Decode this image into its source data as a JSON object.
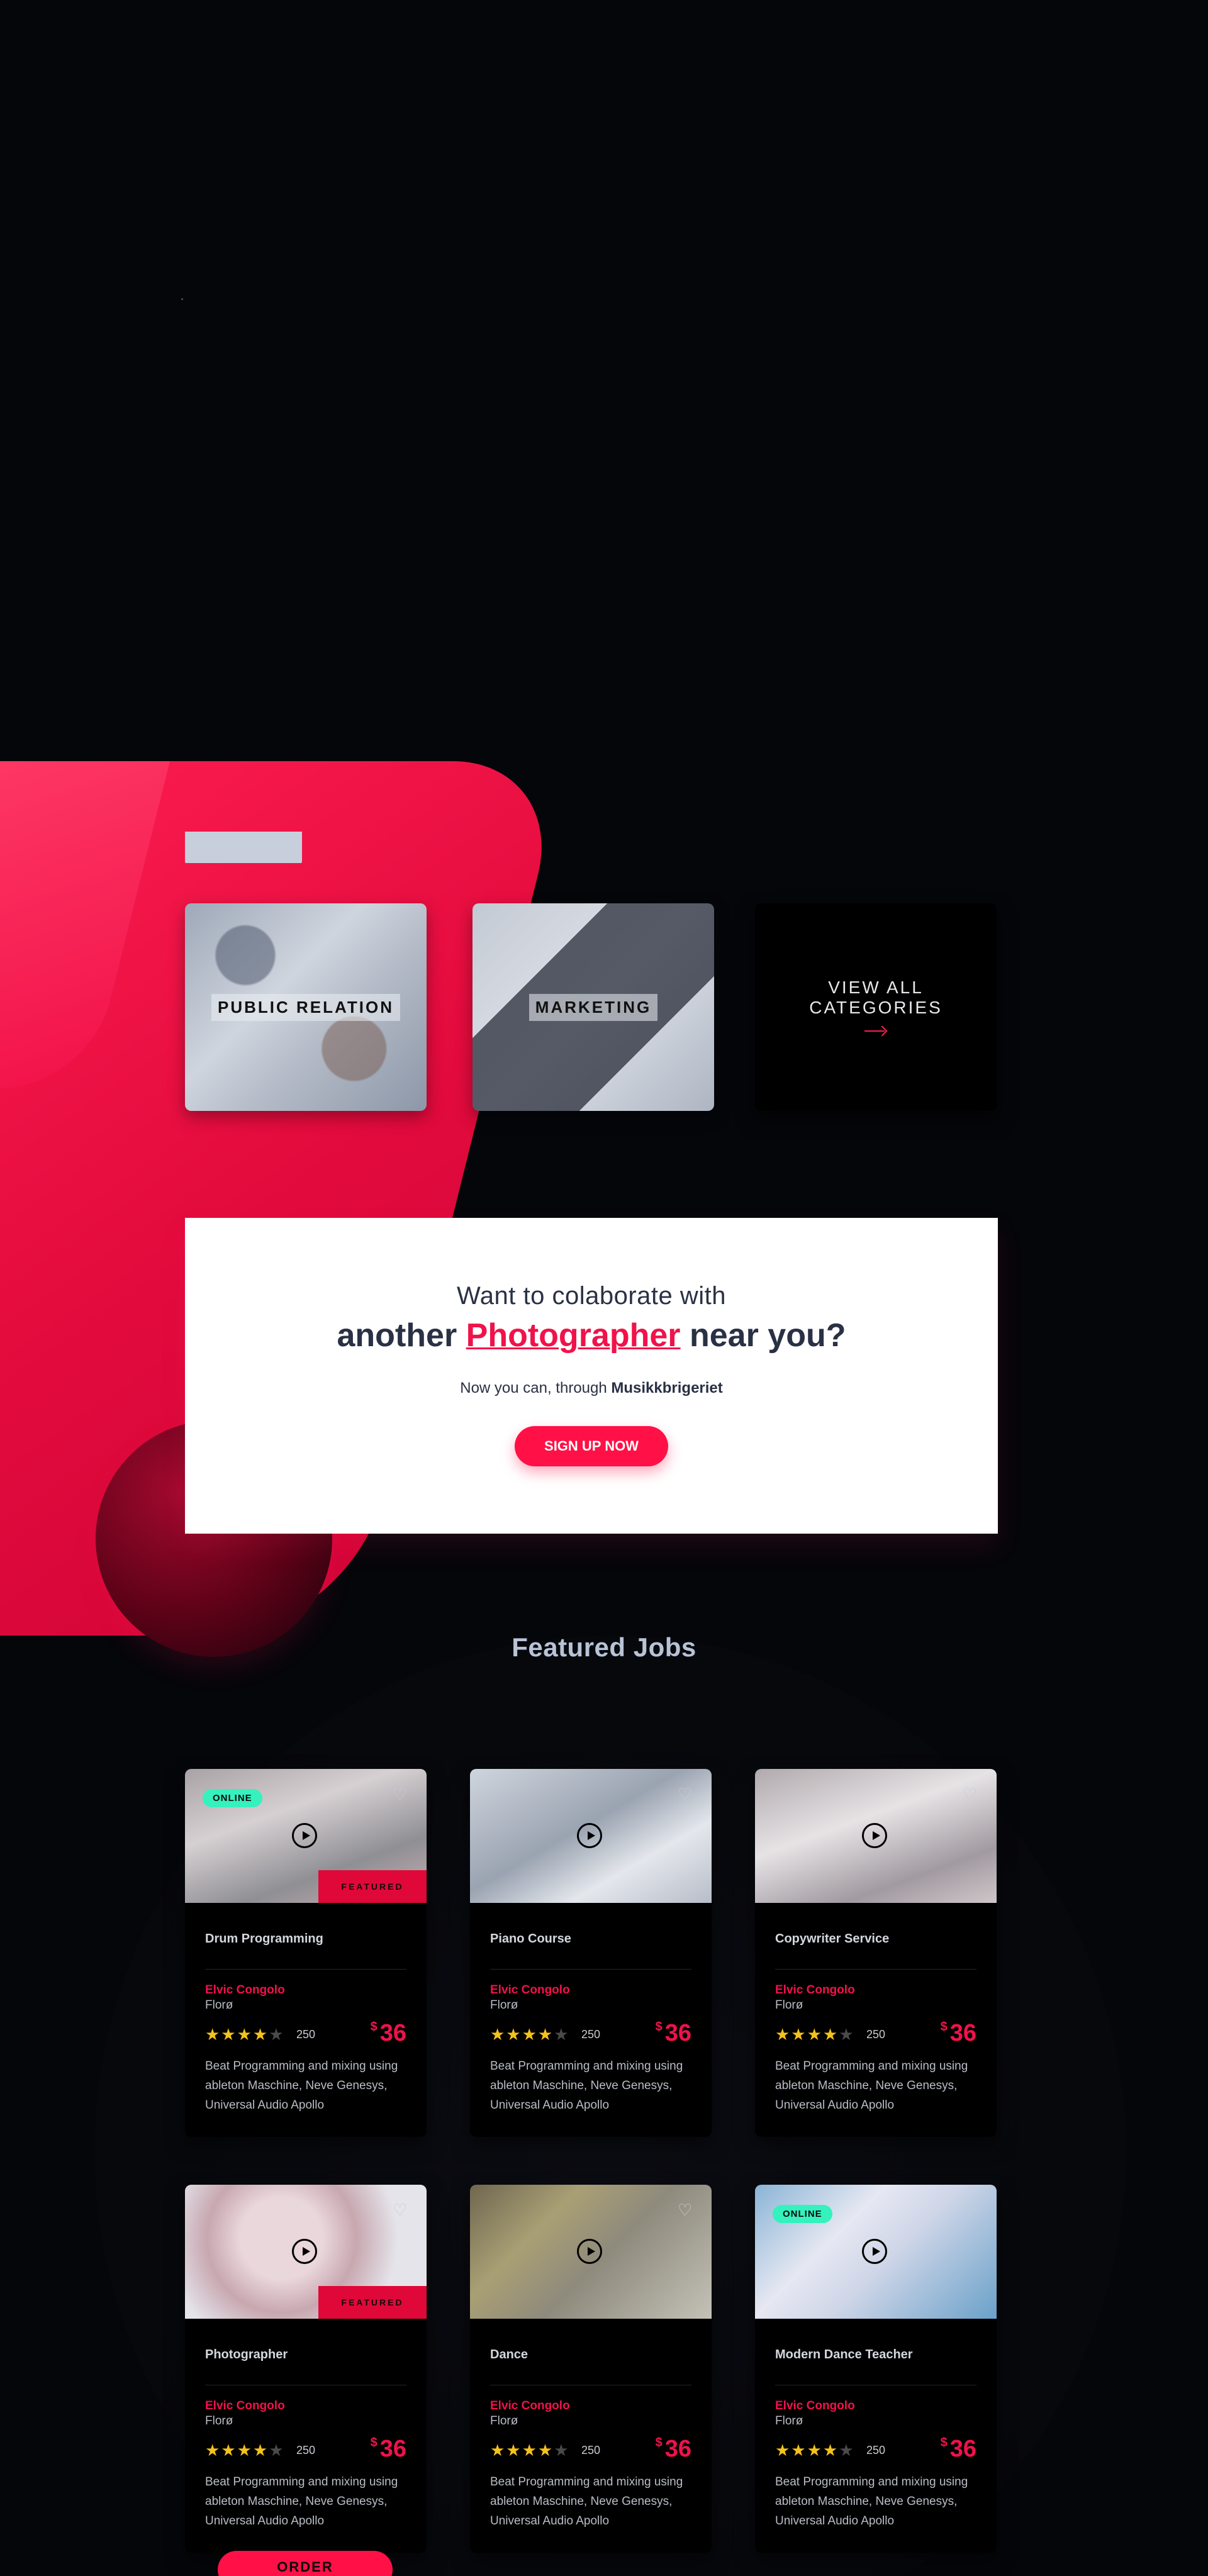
{
  "categories": {
    "items": [
      {
        "label": "PUBLIC RELATION"
      },
      {
        "label": "MARKETING"
      }
    ],
    "view_all": {
      "label": "VIEW ALL CATEGORIES"
    }
  },
  "cta": {
    "line1": "Want to colaborate with",
    "line2_before": "another ",
    "line2_highlight": "Photographer",
    "line2_after": " near you?",
    "line3_before": "Now you can, through ",
    "line3_brand": "Musikkbrigeriet",
    "button": "SIGN UP NOW"
  },
  "featured": {
    "title": "Featured Jobs",
    "jobs": [
      {
        "title": "Drum Programming",
        "author": "Elvic Congolo",
        "location": "Florø",
        "rating": 4,
        "count": "250",
        "currency": "$",
        "price": "36",
        "description": "Beat Programming and mixing using ableton Maschine, Neve Genesys, Universal Audio Apollo",
        "online": "ONLINE",
        "featured": "FEATURED"
      },
      {
        "title": "Piano Course",
        "author": "Elvic Congolo",
        "location": "Florø",
        "rating": 4,
        "count": "250",
        "currency": "$",
        "price": "36",
        "description": "Beat Programming and mixing using ableton Maschine, Neve Genesys, Universal Audio Apollo",
        "online": "",
        "featured": ""
      },
      {
        "title": "Copywriter Service",
        "author": "Elvic Congolo",
        "location": "Florø",
        "rating": 4,
        "count": "250",
        "currency": "$",
        "price": "36",
        "description": "Beat Programming and mixing using ableton Maschine, Neve Genesys, Universal Audio Apollo",
        "online": "",
        "featured": ""
      },
      {
        "title": "Photographer",
        "author": "Elvic Congolo",
        "location": "Florø",
        "rating": 4,
        "count": "250",
        "currency": "$",
        "price": "36",
        "description": "Beat Programming and mixing using ableton Maschine, Neve Genesys, Universal Audio Apollo",
        "online": "",
        "featured": "FEATURED"
      },
      {
        "title": "Dance",
        "author": "Elvic Congolo",
        "location": "Florø",
        "rating": 4,
        "count": "250",
        "currency": "$",
        "price": "36",
        "description": "Beat Programming and mixing using ableton Maschine, Neve Genesys, Universal Audio Apollo",
        "online": "",
        "featured": ""
      },
      {
        "title": "Modern Dance Teacher",
        "author": "Elvic Congolo",
        "location": "Florø",
        "rating": 4,
        "count": "250",
        "currency": "$",
        "price": "36",
        "description": "Beat Programming and mixing using ableton Maschine, Neve Genesys, Universal Audio Apollo",
        "online": "ONLINE",
        "featured": ""
      }
    ],
    "order_button": "ORDER"
  },
  "colors": {
    "accent": "#ff1046",
    "online_badge": "#35f1bd",
    "star": "#f5c21b",
    "background": "#05060a"
  },
  "icons": {
    "heart": "heart-icon",
    "play": "play-icon",
    "arrow": "arrow-right-icon",
    "star": "star-icon"
  }
}
